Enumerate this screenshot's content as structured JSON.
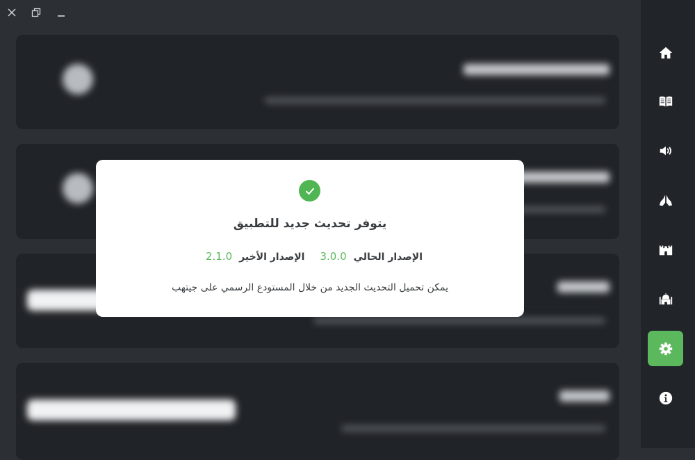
{
  "window": {
    "controls": [
      "close-icon",
      "restore-icon",
      "minimize-icon"
    ]
  },
  "sidebar": {
    "items": [
      {
        "name": "home",
        "icon": "home-icon",
        "active": false
      },
      {
        "name": "quran",
        "icon": "open-book-icon",
        "active": false
      },
      {
        "name": "audio",
        "icon": "speaker-icon",
        "active": false
      },
      {
        "name": "duas",
        "icon": "praying-hands-icon",
        "active": false
      },
      {
        "name": "fortress",
        "icon": "castle-icon",
        "active": false
      },
      {
        "name": "mosque",
        "icon": "mosque-icon",
        "active": false
      },
      {
        "name": "settings",
        "icon": "gear-icon",
        "active": true
      },
      {
        "name": "about",
        "icon": "info-icon",
        "active": false
      }
    ]
  },
  "dialog": {
    "title": "يتوفر تحديث جديد للتطبيق",
    "current_label": "الإصدار الحالي",
    "current_version": "3.0.0",
    "latest_label": "الإصدار الأخير",
    "latest_version": "2.1.0",
    "message": "يمكن تحميل التحديث الجديد من خلال المستودع الرسمي على جيتهب"
  },
  "colors": {
    "accent": "#5cb85c",
    "sidebar_bg": "#212428",
    "app_bg": "#2c3035",
    "card_bg": "#202327"
  }
}
